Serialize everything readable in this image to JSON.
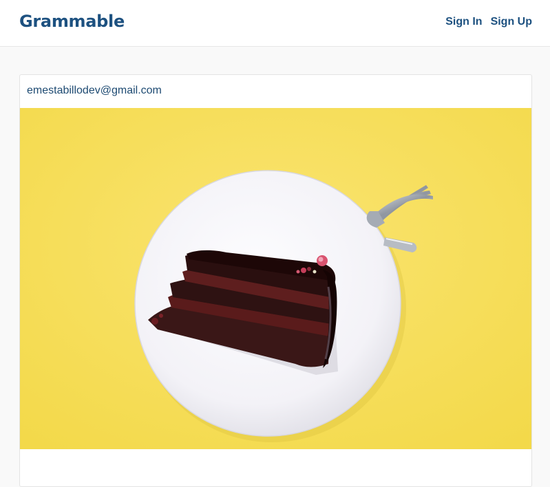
{
  "navbar": {
    "brand": "Grammable",
    "links": [
      "Sign In",
      "Sign Up"
    ]
  },
  "post": {
    "user_email": "emestabillodev@gmail.com",
    "image_alt": "chocolate-cake-slice-photo"
  },
  "colors": {
    "brand": "#1d5180",
    "background": "#f9f9f9",
    "photo_background": "#f6df55"
  }
}
